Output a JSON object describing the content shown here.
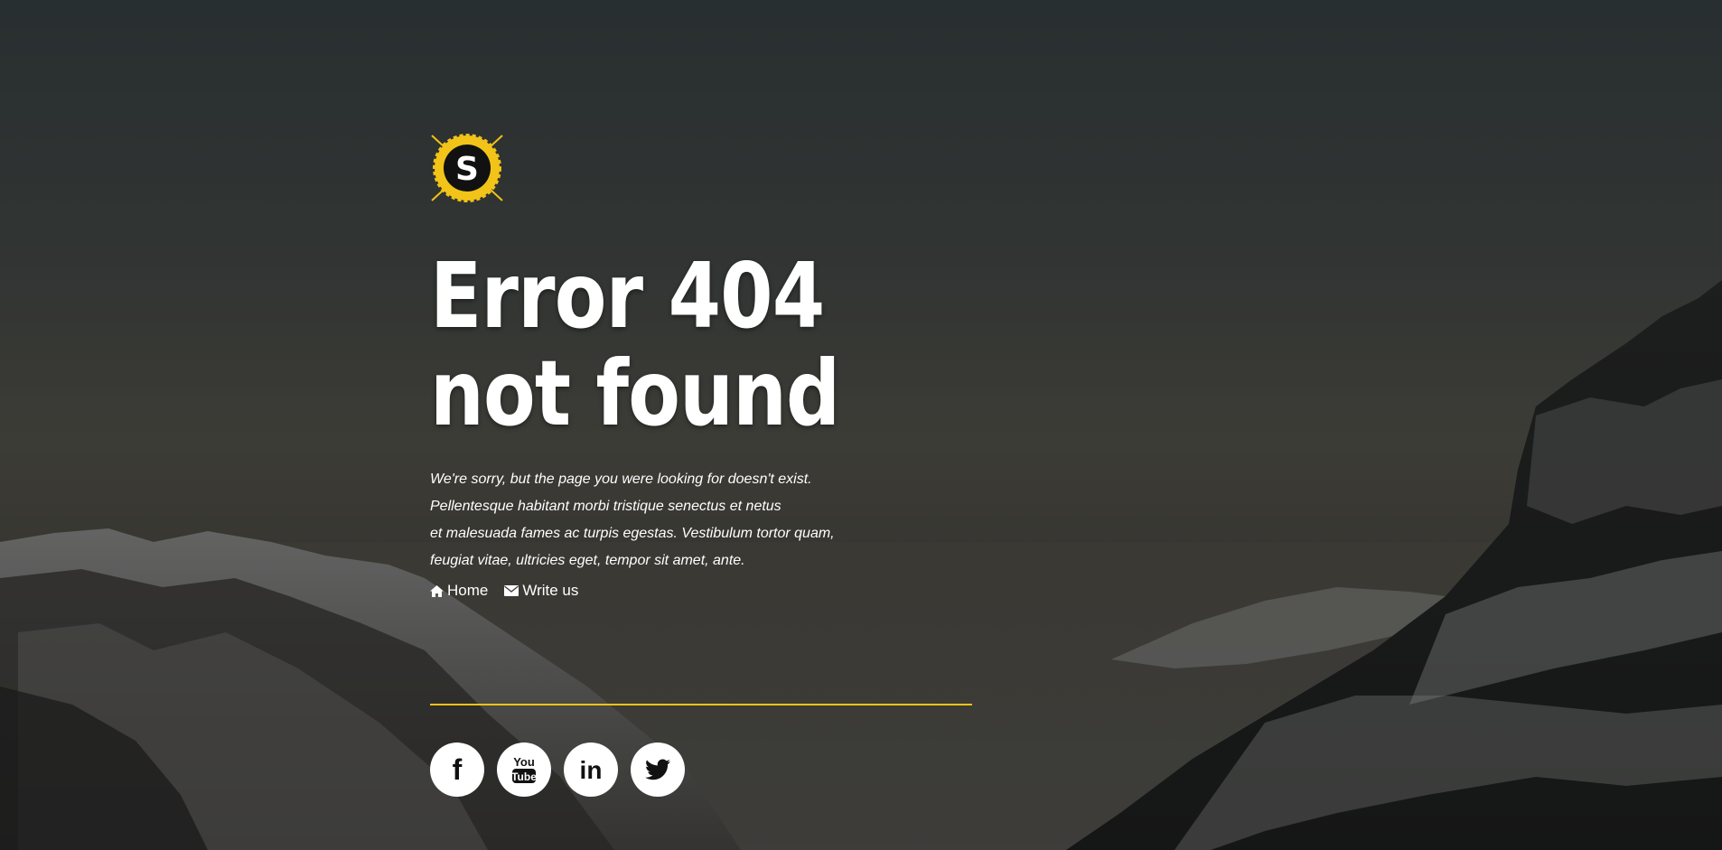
{
  "brand": {
    "logo_letter": "S",
    "accent_color": "#f2c318"
  },
  "error": {
    "line1": "Error 404",
    "line2": "not found",
    "message_lines": [
      "We're sorry, but the page you were looking for doesn't exist.",
      "Pellentesque habitant morbi tristique senectus et netus",
      "et malesuada fames ac turpis egestas. Vestibulum tortor quam,",
      "feugiat vitae, ultricies eget, tempor sit amet, ante."
    ]
  },
  "links": [
    {
      "label": "Home",
      "icon": "home-icon"
    },
    {
      "label": "Write us",
      "icon": "envelope-icon"
    }
  ],
  "social": [
    {
      "name": "facebook",
      "icon": "facebook-icon",
      "label": "f"
    },
    {
      "name": "youtube",
      "icon": "youtube-icon",
      "label_top": "You",
      "label_bottom": "Tube"
    },
    {
      "name": "linkedin",
      "icon": "linkedin-icon",
      "label": "in"
    },
    {
      "name": "twitter",
      "icon": "twitter-icon"
    }
  ]
}
